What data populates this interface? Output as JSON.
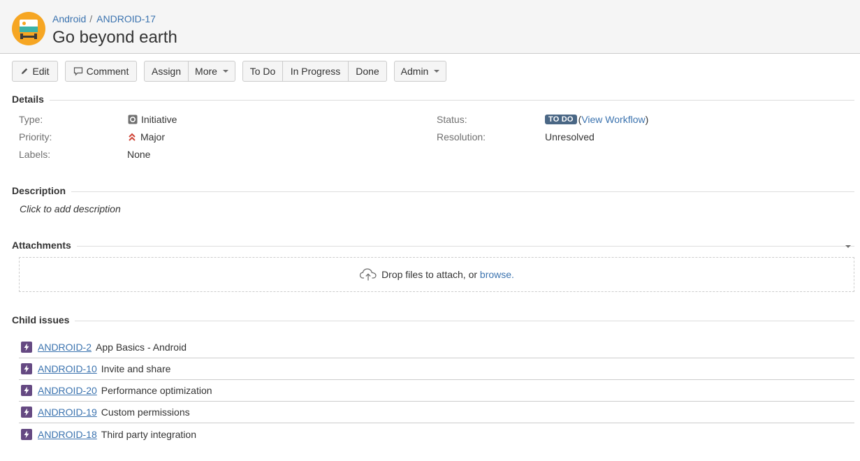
{
  "header": {
    "breadcrumb": {
      "project": "Android",
      "separator": "/",
      "issue_key": "ANDROID-17"
    },
    "title": "Go beyond earth",
    "avatar_icon": "project-avatar-icon"
  },
  "toolbar": {
    "edit_label": "Edit",
    "comment_label": "Comment",
    "assign_label": "Assign",
    "more_label": "More",
    "todo_label": "To Do",
    "in_progress_label": "In Progress",
    "done_label": "Done",
    "admin_label": "Admin"
  },
  "details": {
    "heading": "Details",
    "type_label": "Type:",
    "type_value": "Initiative",
    "priority_label": "Priority:",
    "priority_value": "Major",
    "labels_label": "Labels:",
    "labels_value": "None",
    "status_label": "Status:",
    "status_value": "TO DO",
    "status_open_paren": "(",
    "view_workflow": "View Workflow",
    "status_close_paren": ")",
    "resolution_label": "Resolution:",
    "resolution_value": "Unresolved"
  },
  "description": {
    "heading": "Description",
    "placeholder": "Click to add description"
  },
  "attachments": {
    "heading": "Attachments",
    "drop_text": "Drop files to attach, or",
    "browse_link": "browse."
  },
  "child_issues": {
    "heading": "Child issues",
    "items": [
      {
        "key": "ANDROID-2",
        "summary": "App Basics - Android"
      },
      {
        "key": "ANDROID-10",
        "summary": "Invite and share"
      },
      {
        "key": "ANDROID-20",
        "summary": "Performance optimization"
      },
      {
        "key": "ANDROID-19",
        "summary": "Custom permissions"
      },
      {
        "key": "ANDROID-18",
        "summary": "Third party integration"
      }
    ]
  },
  "colors": {
    "link": "#3b73af",
    "status_lozenge": "#4a6785",
    "priority_major": "#d04437",
    "epic_icon": "#654982",
    "avatar_bg": "#f6a623"
  }
}
